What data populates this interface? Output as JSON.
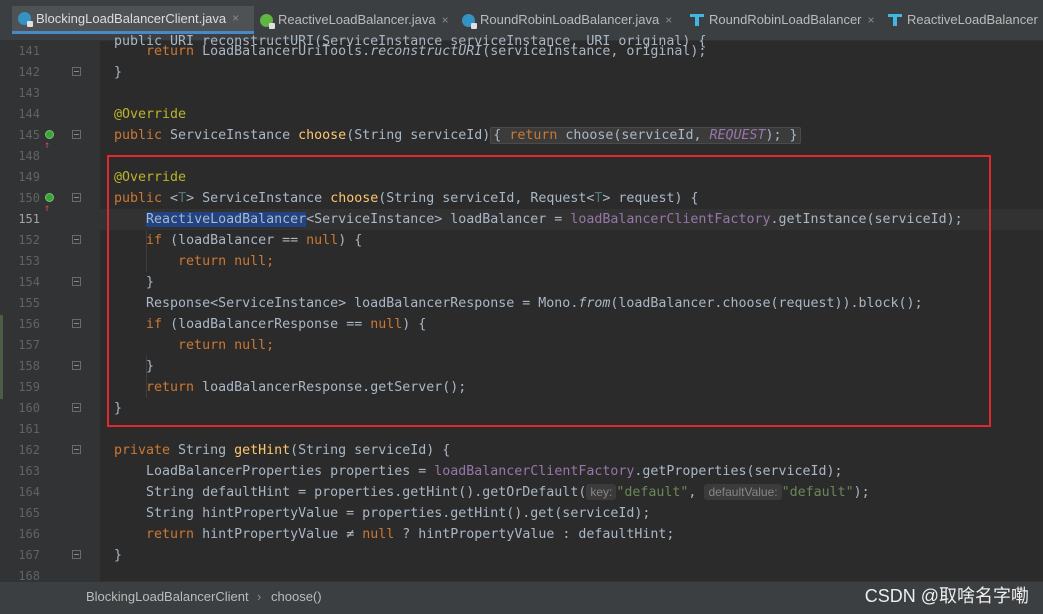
{
  "tabs": [
    {
      "label": "BlockingLoadBalancerClient.java",
      "icon": "class-file-icon",
      "active": true
    },
    {
      "label": "ReactiveLoadBalancer.java",
      "icon": "interface-file-icon",
      "active": false
    },
    {
      "label": "RoundRobinLoadBalancer.java",
      "icon": "class-file-icon",
      "active": false
    },
    {
      "label": "RoundRobinLoadBalancer",
      "icon": "class-structure-icon",
      "active": false
    },
    {
      "label": "ReactiveLoadBalancer",
      "icon": "class-structure-icon",
      "active": false
    }
  ],
  "close_glyph": "×",
  "line_numbers": [
    "141",
    "142",
    "143",
    "144",
    "145",
    "148",
    "149",
    "150",
    "151",
    "152",
    "153",
    "154",
    "155",
    "156",
    "157",
    "158",
    "159",
    "160",
    "161",
    "162",
    "163",
    "164",
    "165",
    "166",
    "167",
    "168"
  ],
  "current_line": "151",
  "code": {
    "top_partial": "public URI reconstructURI(ServiceInstance serviceInstance, URI original) {",
    "l141": {
      "kw": "return ",
      "a": "LoadBalancerUriTools.",
      "m": "reconstructURI",
      "b": "(serviceInstance, original);"
    },
    "l142": "}",
    "l144": "@Override",
    "l145": {
      "kw": "public ",
      "a": "ServiceInstance ",
      "fn": "choose",
      "b": "(String serviceId)",
      "fold_open": "{ ",
      "kw2": "return ",
      "c": "choose(serviceId, ",
      "fld": "REQUEST",
      "d": ");",
      "fold_close": " }"
    },
    "l149": "@Override",
    "l150": {
      "kw": "public ",
      "lt": "<",
      "tp": "T",
      "gt": "> ",
      "a": "ServiceInstance ",
      "fn": "choose",
      "b": "(String serviceId, Request<",
      "tp2": "T",
      "c": "> request) {"
    },
    "l151": {
      "sel": "ReactiveLoadBalancer",
      "a": "<ServiceInstance> loadBalancer = ",
      "fld": "loadBalancerClientFactory",
      "b": ".getInstance(serviceId);"
    },
    "l152": {
      "kw": "if ",
      "a": "(loadBalancer ",
      "op": "==",
      "b": " ",
      "kw2": "null",
      "c": ") {"
    },
    "l153": {
      "kw": "return null",
      "a": ";"
    },
    "l154": "}",
    "l155": {
      "a": "Response<ServiceInstance> loadBalancerResponse = Mono.",
      "m": "from",
      "b": "(loadBalancer.choose(request)).block();"
    },
    "l156": {
      "kw": "if ",
      "a": "(loadBalancerResponse ",
      "op": "==",
      "b": " ",
      "kw2": "null",
      "c": ") {"
    },
    "l157": {
      "kw": "return null",
      "a": ";"
    },
    "l158": "}",
    "l159": {
      "kw": "return ",
      "a": "loadBalancerResponse.getServer();"
    },
    "l160": "}",
    "l162": {
      "kw": "private ",
      "a": "String ",
      "fn": "getHint",
      "b": "(String serviceId) {"
    },
    "l163": {
      "a": "LoadBalancerProperties properties = ",
      "fld": "loadBalancerClientFactory",
      "b": ".getProperties(serviceId);"
    },
    "l164": {
      "a": "String defaultHint = properties.getHint().getOrDefault(",
      "hint1": "key:",
      "s1": "\"default\"",
      "c1": ", ",
      "hint2": "defaultValue:",
      "s2": "\"default\"",
      "b": ");"
    },
    "l165": {
      "a": "String hintPropertyValue = properties.getHint().get(serviceId);"
    },
    "l166": {
      "kw": "return ",
      "a": "hintPropertyValue ",
      "op": "≠",
      "b": " ",
      "kw2": "null",
      "c": " ? hintPropertyValue : defaultHint;"
    },
    "l167": "}"
  },
  "breadcrumb": {
    "class": "BlockingLoadBalancerClient",
    "sep": "›",
    "method": "choose()"
  },
  "watermark": "CSDN @取啥名字嘞"
}
